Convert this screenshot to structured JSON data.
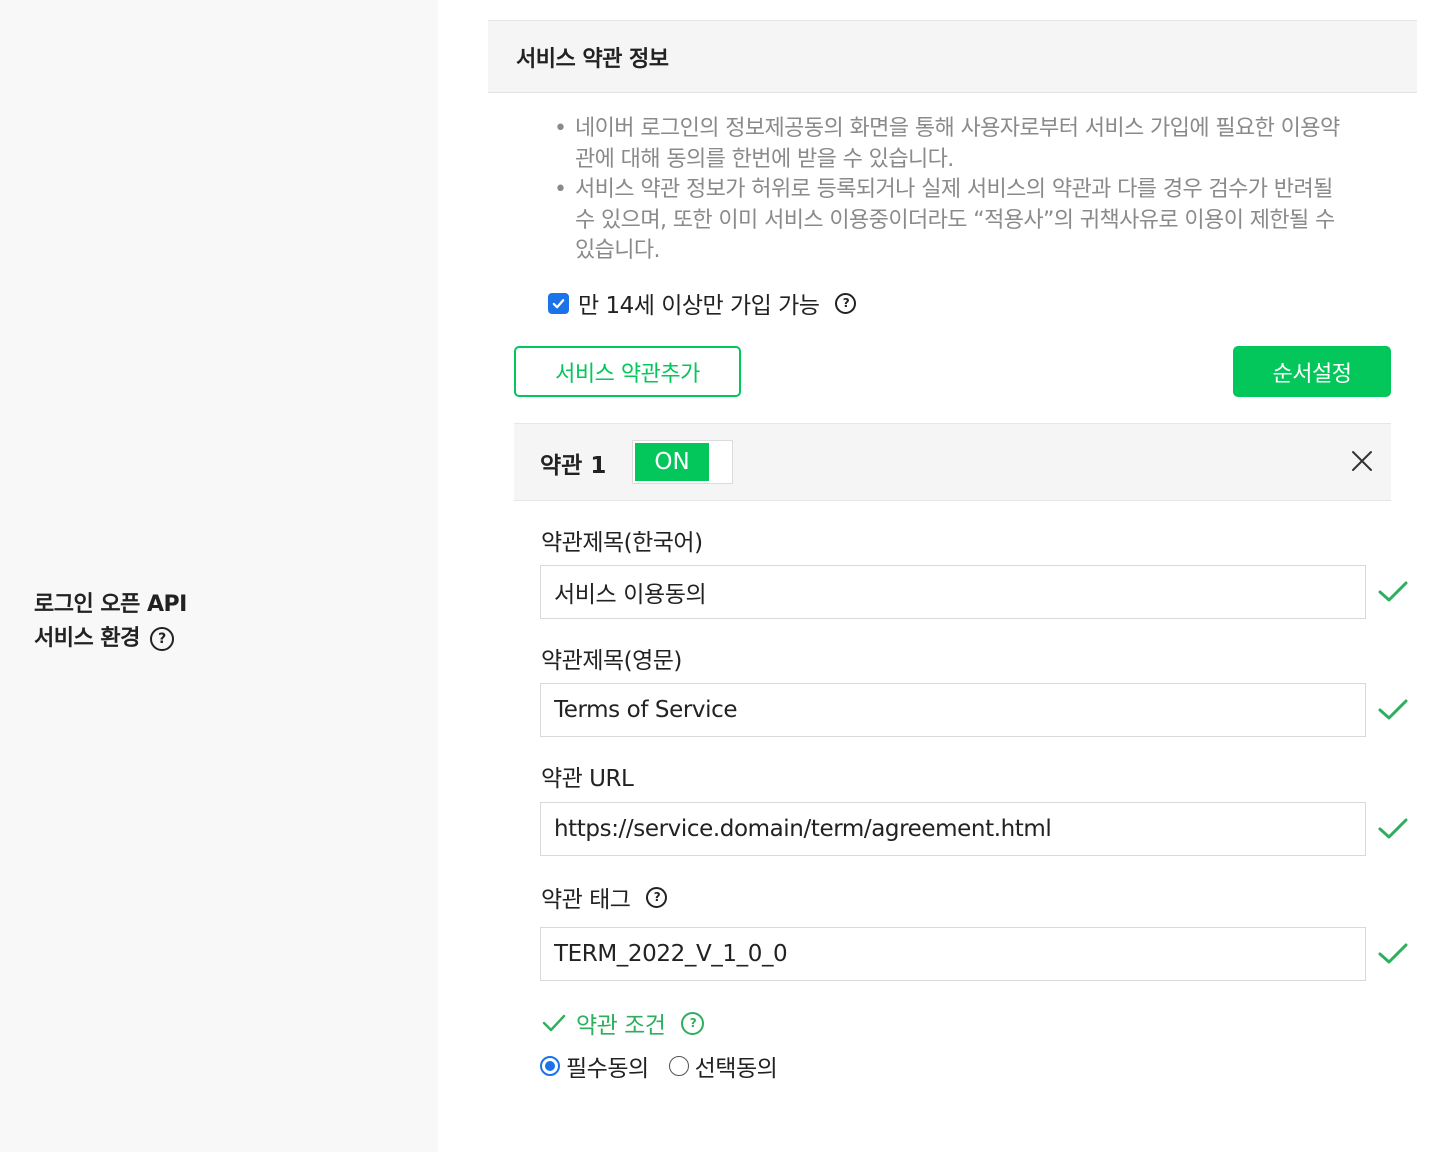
{
  "sidebar": {
    "title_line1": "로그인 오픈 API",
    "title_line2": "서비스 환경",
    "help_icon": "question-circle-icon"
  },
  "section": {
    "title": "서비스 약관 정보"
  },
  "notes": [
    "네이버 로그인의 정보제공동의 화면을 통해 사용자로부터 서비스 가입에 필요한 이용약관에 대해 동의를 한번에 받을 수 있습니다.",
    "서비스 약관 정보가 허위로 등록되거나 실제 서비스의 약관과 다를 경우 검수가 반려될 수 있으며, 또한 이미 서비스 이용중이더라도 “적용사”의 귀책사유로 이용이 제한될 수 있습니다."
  ],
  "age_limit": {
    "label": "만 14세 이상만 가입 가능",
    "checked": true
  },
  "buttons": {
    "add_terms": "서비스 약관추가",
    "set_order": "순서설정"
  },
  "term": {
    "title": "약관 1",
    "toggle_label": "ON",
    "fields": {
      "title_ko_label": "약관제목(한국어)",
      "title_ko_value": "서비스 이용동의",
      "title_en_label": "약관제목(영문)",
      "title_en_value": "Terms of Service",
      "url_label": "약관 URL",
      "url_value": "https://service.domain/term/agreement.html",
      "tag_label": "약관 태그",
      "tag_value": "TERM_2022_V_1_0_0"
    },
    "condition_label": "약관 조건",
    "condition_options": [
      "필수동의",
      "선택동의"
    ],
    "condition_selected": "필수동의"
  },
  "colors": {
    "brand_green": "#03c75a",
    "check_green": "#2fae5e",
    "checkbox_blue": "#1a73e8",
    "note_gray": "#8a8a8a"
  }
}
